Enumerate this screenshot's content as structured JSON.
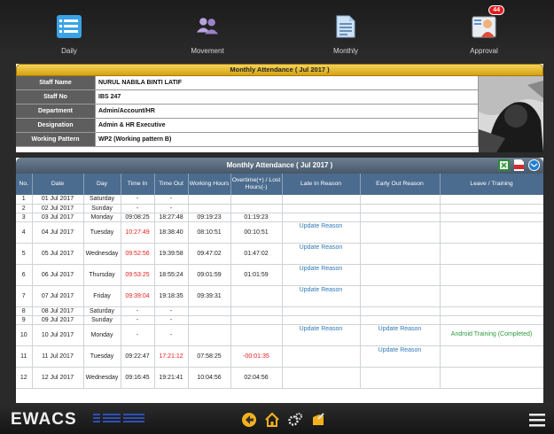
{
  "topnav": {
    "items": [
      {
        "label": "Daily",
        "icon": "daily-list-icon"
      },
      {
        "label": "Movement",
        "icon": "movement-people-icon"
      },
      {
        "label": "Monthly",
        "icon": "monthly-document-icon"
      },
      {
        "label": "Approval",
        "icon": "approval-user-icon",
        "badge": "44"
      }
    ]
  },
  "staff_panel": {
    "title": "Monthly Attendance ( Jul 2017 )",
    "rows": [
      {
        "label": "Staff Name",
        "value": "NURUL NABILA BINTI LATIF"
      },
      {
        "label": "Staff No",
        "value": "IBS 247"
      },
      {
        "label": "Department",
        "value": "Admin/Account/HR"
      },
      {
        "label": "Designation",
        "value": "Admin & HR Executive"
      },
      {
        "label": "Working Pattern",
        "value": "WP2 (Working pattern B)"
      }
    ]
  },
  "attendance": {
    "title": "Monthly Attendance ( Jul 2017 )",
    "columns": [
      "No.",
      "Date",
      "Day",
      "Time In",
      "Time Out",
      "Working Hours",
      "Overtime(+) / Lost Hours(-)",
      "Late In Reason",
      "Early Out Reason",
      "Leave / Training"
    ],
    "rows": [
      {
        "no": "1",
        "date": "01 Jul 2017",
        "day": "Saturday",
        "in": "-",
        "out": "-",
        "work": "",
        "ot": "",
        "late": "",
        "early": "",
        "leave": ""
      },
      {
        "no": "2",
        "date": "02 Jul 2017",
        "day": "Sunday",
        "in": "-",
        "out": "-",
        "work": "",
        "ot": "",
        "late": "",
        "early": "",
        "leave": ""
      },
      {
        "no": "3",
        "date": "03 Jul 2017",
        "day": "Monday",
        "in": "09:08:25",
        "out": "18:27:48",
        "work": "09:19:23",
        "ot": "01:19:23",
        "late": "",
        "early": "",
        "leave": ""
      },
      {
        "no": "4",
        "date": "04 Jul 2017",
        "day": "Tuesday",
        "in": "10:27:49",
        "out": "18:38:40",
        "work": "08:10:51",
        "ot": "00:10:51",
        "late": "Update Reason",
        "early": "",
        "leave": ""
      },
      {
        "no": "5",
        "date": "05 Jul 2017",
        "day": "Wednesday",
        "in": "09:52:56",
        "out": "19:39:58",
        "work": "09:47:02",
        "ot": "01:47:02",
        "late": "Update Reason",
        "early": "",
        "leave": ""
      },
      {
        "no": "6",
        "date": "06 Jul 2017",
        "day": "Thursday",
        "in": "09:53:25",
        "out": "18:55:24",
        "work": "09:01:59",
        "ot": "01:01:59",
        "late": "Update Reason",
        "early": "",
        "leave": ""
      },
      {
        "no": "7",
        "date": "07 Jul 2017",
        "day": "Friday",
        "in": "09:39:04",
        "out": "19:18:35",
        "work": "09:39:31",
        "ot": "",
        "late": "Update Reason",
        "early": "",
        "leave": ""
      },
      {
        "no": "8",
        "date": "08 Jul 2017",
        "day": "Saturday",
        "in": "-",
        "out": "-",
        "work": "",
        "ot": "",
        "late": "",
        "early": "",
        "leave": ""
      },
      {
        "no": "9",
        "date": "09 Jul 2017",
        "day": "Sunday",
        "in": "-",
        "out": "-",
        "work": "",
        "ot": "",
        "late": "",
        "early": "",
        "leave": ""
      },
      {
        "no": "10",
        "date": "10 Jul 2017",
        "day": "Monday",
        "in": "-",
        "out": "-",
        "work": "",
        "ot": "",
        "late": "Update Reason",
        "early": "Update Reason",
        "leave": "Android Training (Completed)"
      },
      {
        "no": "11",
        "date": "11 Jul 2017",
        "day": "Tuesday",
        "in": "09:22:47",
        "out": "17:21:12",
        "work": "07:58:25",
        "ot": "-00:01:35",
        "late": "",
        "early": "Update Reason",
        "leave": ""
      },
      {
        "no": "12",
        "date": "12 Jul 2017",
        "day": "Wednesday",
        "in": "09:16:45",
        "out": "19:21:41",
        "work": "10:04:56",
        "ot": "02:04:56",
        "late": "",
        "early": "",
        "leave": ""
      }
    ]
  },
  "footer": {
    "brand": "EWACS",
    "partner_logo": "IBS"
  },
  "colors": {
    "late_red": "#e12020",
    "link_blue": "#2f78b8",
    "header_gold": "#d6a20f",
    "table_head": "#4b6c8f",
    "training_green": "#2e9a3d"
  }
}
